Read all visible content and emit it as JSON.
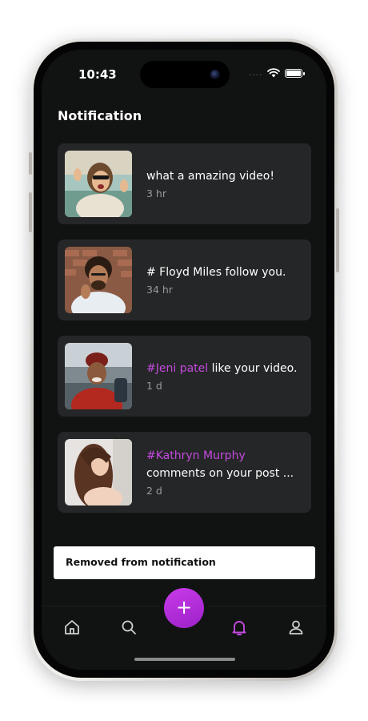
{
  "status_bar": {
    "time": "10:43",
    "dots": "...."
  },
  "page": {
    "title": "Notification"
  },
  "notifications": [
    {
      "hashtag": "",
      "text": "what a amazing video!",
      "time": "3 hr"
    },
    {
      "hashtag": "",
      "text": "# Floyd Miles follow you.",
      "time": "34 hr"
    },
    {
      "hashtag": "#Jeni patel",
      "text": " like your video.",
      "time": "1 d"
    },
    {
      "hashtag": "#Kathryn Murphy",
      "text": "comments  on your post  ...",
      "time": "2 d"
    }
  ],
  "snackbar": {
    "message": "Removed from notification"
  },
  "fab": {
    "label": "+"
  },
  "colors": {
    "accent": "#c44ae0",
    "card": "#252627",
    "background": "#111212"
  },
  "icons": {
    "nav": [
      "home-icon",
      "search-icon",
      "bell-icon",
      "profile-icon"
    ],
    "active": "bell-icon"
  }
}
